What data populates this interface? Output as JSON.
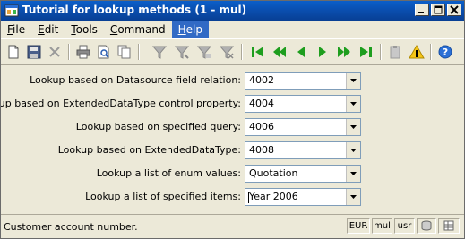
{
  "window": {
    "title": "Tutorial for lookup methods (1 - mul)"
  },
  "menu": [
    {
      "label": "File",
      "accel": "F",
      "rest": "ile"
    },
    {
      "label": "Edit",
      "accel": "E",
      "rest": "dit"
    },
    {
      "label": "Tools",
      "accel": "T",
      "rest": "ools"
    },
    {
      "label": "Command",
      "accel": "C",
      "rest": "ommand"
    },
    {
      "label": "Help",
      "accel": "H",
      "rest": "elp"
    }
  ],
  "form": {
    "rows": [
      {
        "label": "Lookup based on Datasource field relation:",
        "value": "4002"
      },
      {
        "label": "Lookup based on ExtendedDataType control property:",
        "value": "4004"
      },
      {
        "label": "Lookup based on specified query:",
        "value": "4006"
      },
      {
        "label": "Lookup based on ExtendedDataType:",
        "value": "4008"
      },
      {
        "label": "Lookup a list of enum values:",
        "value": "Quotation"
      },
      {
        "label": "Lookup a list of specified items:",
        "value": "Year 2006"
      }
    ]
  },
  "status": {
    "text": "Customer account number.",
    "currency": "EUR",
    "company": "mul",
    "layer": "usr"
  },
  "colors": {
    "title_bar": "#0a4fb0",
    "menu_active": "#316ac5",
    "window_bg": "#ece9d8",
    "green_nav": "#1e9e1e"
  }
}
